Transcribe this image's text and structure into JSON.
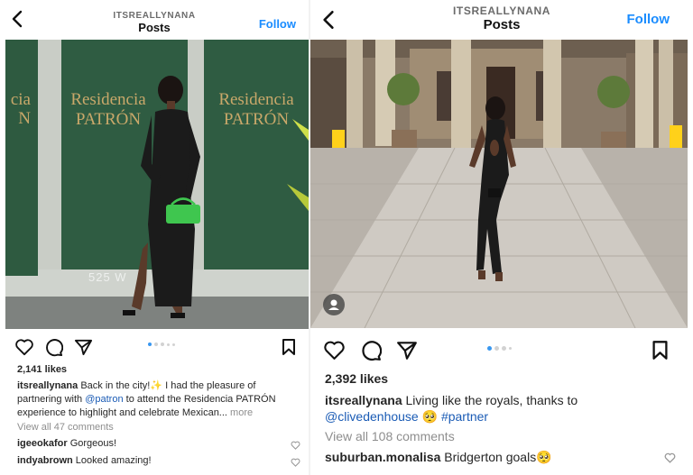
{
  "left_post": {
    "header": {
      "username": "ITSREALLYNANA",
      "title": "Posts",
      "follow_label": "Follow"
    },
    "photo": {
      "sign_line1": "Residencia",
      "sign_line2": "PATRÓN",
      "sign_partial1": "cia",
      "sign_partial2": "N",
      "address": "525 W"
    },
    "likes": "2,141 likes",
    "caption": {
      "username": "itsreallynana",
      "part1": "Back in the city!",
      "sparkle": "✨",
      "part2": "I had the pleasure of partnering with",
      "mention": "@patron",
      "part3": "to attend the Residencia PATRÓN experience to highlight and celebrate Mexican...",
      "more": "more"
    },
    "view_all": "View all 47 comments",
    "comments": [
      {
        "user": "igeeokafor",
        "text": "Gorgeous!"
      },
      {
        "user": "indyabrown",
        "text": "Looked amazing!"
      }
    ],
    "carousel": {
      "count": 5,
      "active_index": 0
    }
  },
  "right_post": {
    "header": {
      "username": "ITSREALLYNANA",
      "title": "Posts",
      "follow_label": "Follow"
    },
    "likes": "2,392 likes",
    "caption": {
      "username": "itsreallynana",
      "part1": "Living like the royals, thanks to",
      "mention": "@clivedenhouse",
      "emoji": "🥺",
      "tag": "#partner"
    },
    "view_all": "View all 108 comments",
    "comments": [
      {
        "user": "suburban.monalisa",
        "text": "Bridgerton goals",
        "emoji": "🥺"
      }
    ],
    "carousel": {
      "count": 4,
      "active_index": 0
    }
  },
  "colors": {
    "link_blue": "#1a8cff",
    "mention_blue": "#1a5bb5",
    "sign_green": "#2e5a40",
    "gold": "#c9a86a"
  },
  "icons": [
    "back-chevron-icon",
    "heart-icon",
    "comment-icon",
    "share-icon",
    "bookmark-icon",
    "user-tag-icon"
  ]
}
